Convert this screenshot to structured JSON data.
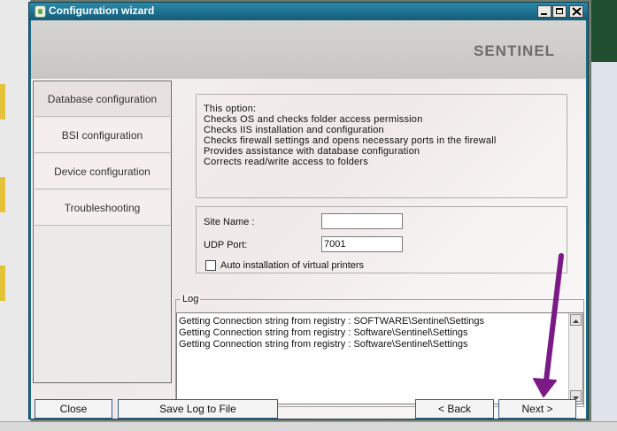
{
  "window": {
    "title": "Configuration wizard",
    "logo_text": "SENTINEL"
  },
  "nav": {
    "items": [
      {
        "label": "Database configuration"
      },
      {
        "label": "BSI configuration"
      },
      {
        "label": "Device configuration"
      },
      {
        "label": "Troubleshooting"
      }
    ]
  },
  "info": {
    "lines": [
      "This option:",
      "Checks OS and checks folder access permission",
      "Checks IIS installation and configuration",
      "Checks firewall settings and opens necessary ports in the firewall",
      "Provides assistance with database configuration",
      "Corrects read/write access to folders"
    ]
  },
  "form": {
    "site_name_label": "Site Name :",
    "site_name_value": "",
    "udp_port_label": "UDP Port:",
    "udp_port_value": "7001",
    "auto_install_label": "Auto installation of virtual printers",
    "auto_install_checked": false
  },
  "log": {
    "legend": "Log",
    "lines": [
      "Getting Connection string from registry : SOFTWARE\\Sentinel\\Settings",
      "Getting Connection string from registry : Software\\Sentinel\\Settings",
      "Getting Connection string from registry : Software\\Sentinel\\Settings"
    ]
  },
  "buttons": {
    "close": "Close",
    "save_log": "Save Log to File",
    "back": "< Back",
    "next": "Next >"
  },
  "colors": {
    "titlebar": "#145c78",
    "annotation_arrow": "#7b1a87",
    "button_border": "#3b5d86"
  },
  "icons": {
    "window_controls": [
      "minimize-icon",
      "maximize-icon",
      "close-icon"
    ],
    "app": "sentinel-app-icon"
  }
}
